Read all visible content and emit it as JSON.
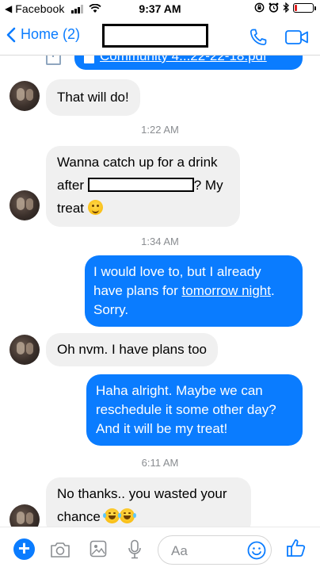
{
  "status_bar": {
    "app": "Facebook",
    "time": "9:37 AM",
    "battery_level": 0.12
  },
  "nav": {
    "back_label": "Home (2)"
  },
  "file_attachment": {
    "name": "Community 4...22-22-18.pdf"
  },
  "messages": [
    {
      "id": 1,
      "side": "in",
      "text": "That will do!"
    },
    {
      "id": 2,
      "timestamp": "1:22 AM"
    },
    {
      "id": 3,
      "side": "in",
      "line1": "Wanna catch up for a drink",
      "line2_pre": "after ",
      "line2_post": "? My",
      "line3": "treat"
    },
    {
      "id": 4,
      "timestamp": "1:34 AM"
    },
    {
      "id": 5,
      "side": "out",
      "line1": "I would love to, but I already",
      "line2_pre": "have plans for ",
      "line2_link": "tomorrow night",
      "line2_post": ".",
      "line3": "Sorry."
    },
    {
      "id": 6,
      "side": "in",
      "text": "Oh nvm. I have plans too"
    },
    {
      "id": 7,
      "side": "out",
      "line1": "Haha alright. Maybe we can",
      "line2": "reschedule it some other day?",
      "line3": "And it will be my treat!"
    },
    {
      "id": 8,
      "timestamp": "6:11 AM"
    },
    {
      "id": 9,
      "side": "in",
      "line1": "No thanks.. you wasted your",
      "line2": "chance"
    }
  ],
  "composer": {
    "placeholder": "Aa"
  },
  "colors": {
    "accent": "#0a7cff",
    "incoming_bubble": "#f0f0f0",
    "timestamp": "#8a8d91"
  },
  "icons": [
    "plus-icon",
    "camera-icon",
    "image-icon",
    "microphone-icon",
    "emoji-icon",
    "thumbs-up-icon",
    "phone-icon",
    "video-camera-icon",
    "chevron-left-icon",
    "wifi-icon",
    "signal-icon",
    "battery-icon",
    "bluetooth-icon",
    "alarm-icon",
    "orientation-lock-icon"
  ]
}
